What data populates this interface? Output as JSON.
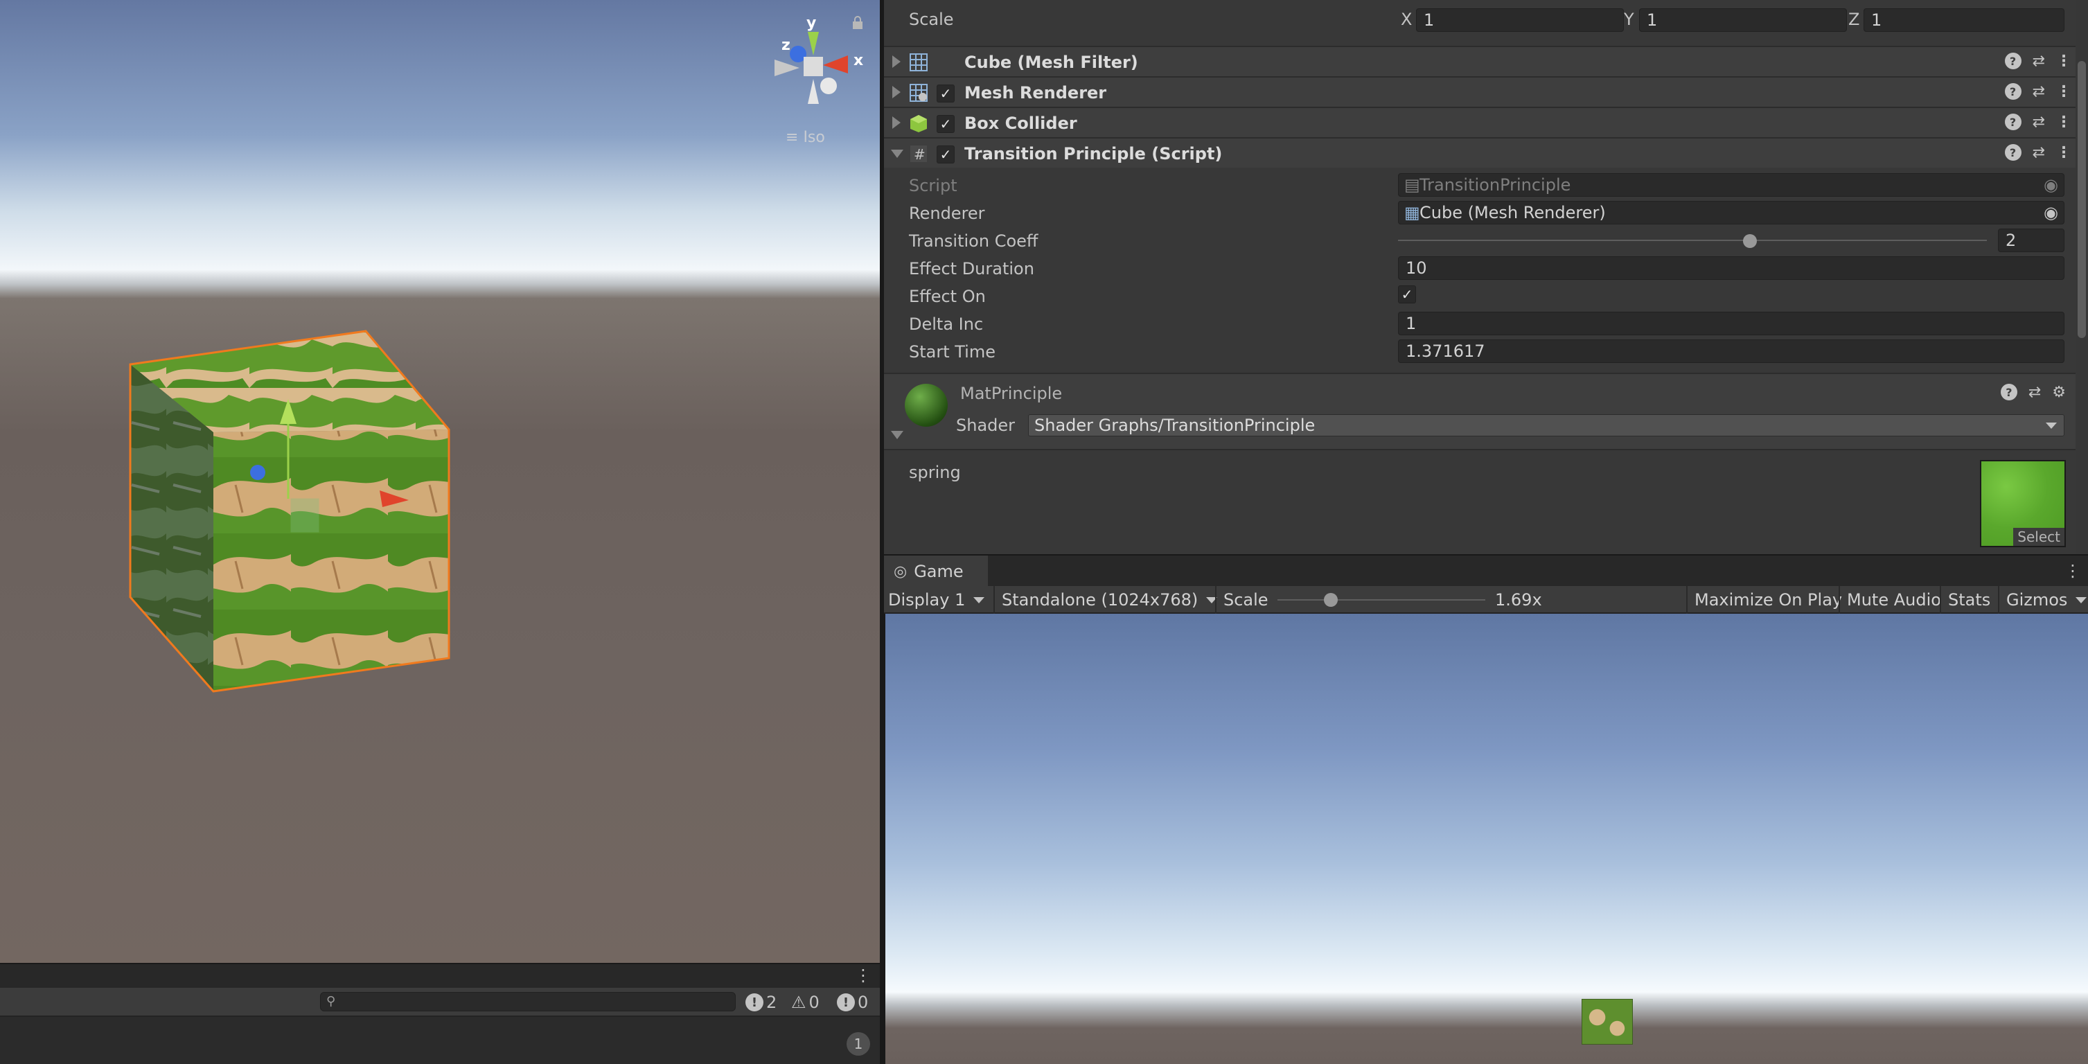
{
  "scene": {
    "gizmo_axes": {
      "x": "x",
      "y": "y",
      "z": "z"
    },
    "projection_label": "Iso"
  },
  "console": {
    "counts": {
      "logs": "2",
      "warnings": "0",
      "errors": "0"
    },
    "badge": "1",
    "search_placeholder": ""
  },
  "inspector": {
    "transform": {
      "scale_label": "Scale",
      "x_label": "X",
      "x_value": "1",
      "y_label": "Y",
      "y_value": "1",
      "z_label": "Z",
      "z_value": "1"
    },
    "components": [
      {
        "title": "Cube (Mesh Filter)",
        "checkbox": false,
        "expanded": false
      },
      {
        "title": "Mesh Renderer",
        "checkbox": true,
        "expanded": false
      },
      {
        "title": "Box Collider",
        "checkbox": true,
        "expanded": false
      },
      {
        "title": "Transition Principle (Script)",
        "checkbox": true,
        "expanded": true
      }
    ],
    "script_fields": {
      "script_label": "Script",
      "script_value": "TransitionPrinciple",
      "renderer_label": "Renderer",
      "renderer_value": "Cube (Mesh Renderer)",
      "coeff_label": "Transition Coeff",
      "coeff_value": "2",
      "coeff_slider_fraction": 0.6,
      "duration_label": "Effect Duration",
      "duration_value": "10",
      "effect_on_label": "Effect On",
      "effect_on_value": true,
      "delta_label": "Delta Inc",
      "delta_value": "1",
      "start_label": "Start Time",
      "start_value": "1.371617"
    },
    "material": {
      "name": "MatPrinciple",
      "shader_label": "Shader",
      "shader_value": "Shader Graphs/TransitionPrinciple",
      "texture_label": "spring",
      "texture_button": "Select"
    }
  },
  "game": {
    "tab_label": "Game",
    "display": "Display 1",
    "resolution": "Standalone (1024x768)",
    "scale_label": "Scale",
    "scale_value": "1.69x",
    "scale_slider_fraction": 0.24,
    "buttons": [
      "Maximize On Play",
      "Mute Audio",
      "Stats",
      "Gizmos"
    ]
  },
  "colors": {
    "accent_x": "#e0442c",
    "accent_y": "#9bd14a",
    "accent_z": "#3c6fe0",
    "selection_outline": "#f07a1e",
    "grass": "#5e8f2e"
  }
}
